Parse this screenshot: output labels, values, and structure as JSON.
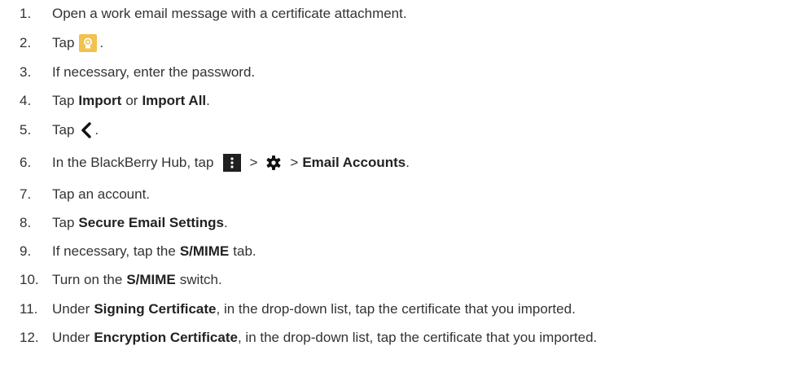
{
  "steps": [
    {
      "num": "1.",
      "text": "Open a work email message with a certificate attachment."
    },
    {
      "num": "2.",
      "pre": "Tap",
      "post": "."
    },
    {
      "num": "3.",
      "text": "If necessary, enter the password."
    },
    {
      "num": "4.",
      "pre": "Tap",
      "b1": "Import",
      "mid": "or",
      "b2": "Import All",
      "post": "."
    },
    {
      "num": "5.",
      "pre": "Tap",
      "post": "."
    },
    {
      "num": "6.",
      "pre": "In the BlackBerry Hub, tap",
      "sep1": ">",
      "sep2": ">",
      "b1": "Email Accounts",
      "post": "."
    },
    {
      "num": "7.",
      "text": "Tap an account."
    },
    {
      "num": "8.",
      "pre": "Tap",
      "b1": "Secure Email Settings",
      "post": "."
    },
    {
      "num": "9.",
      "pre": "If necessary, tap the",
      "b1": "S/MIME",
      "post": "tab."
    },
    {
      "num": "10.",
      "pre": "Turn on the",
      "b1": "S/MIME",
      "post": "switch."
    },
    {
      "num": "11.",
      "pre": "Under",
      "b1": "Signing Certificate",
      "post": ", in the drop-down list, tap the certificate that you imported."
    },
    {
      "num": "12.",
      "pre": "Under",
      "b1": "Encryption Certificate",
      "post": ", in the drop-down list, tap the certificate that you imported."
    }
  ],
  "icons": {
    "step2": "certificate-icon",
    "step5": "back-chevron-icon",
    "step6_menu": "more-vertical-icon",
    "step6_settings": "gear-icon"
  },
  "colors": {
    "text": "#333333",
    "bold": "#222222",
    "certificate_icon_bg": "#f2c14e",
    "menu_icon_bg": "#1f1f1f"
  }
}
